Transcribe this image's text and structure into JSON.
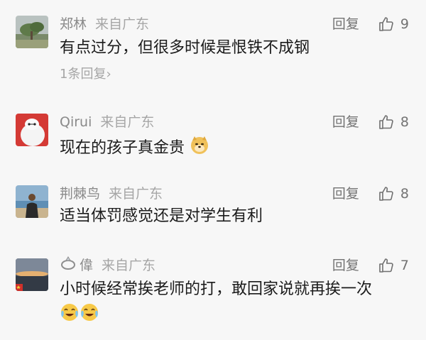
{
  "comments": [
    {
      "name": "郑林",
      "location": "来自广东",
      "reply_label": "回复",
      "likes": "9",
      "text": "有点过分，但很多时候是恨铁不成钢",
      "sub_replies": "1条回复",
      "sub_replies_arrow": "›",
      "avatar_icon": "landscape-avatar"
    },
    {
      "name": "Qirui",
      "location": "来自广东",
      "reply_label": "回复",
      "likes": "8",
      "text": "现在的孩子真金贵",
      "emoji": "doge-emoji",
      "avatar_icon": "baymax-avatar"
    },
    {
      "name": "荆棘鸟",
      "location": "来自广东",
      "reply_label": "回复",
      "likes": "8",
      "text": "适当体罚感觉还是对学生有利",
      "avatar_icon": "person-beach-avatar"
    },
    {
      "name": "偉",
      "name_badge": "ring-icon",
      "location": "来自广东",
      "reply_label": "回复",
      "likes": "7",
      "text": "小时候经常挨老师的打，敢回家说就再挨一次",
      "emoji": "crying-laughing-emoji",
      "avatar_icon": "sunset-avatar"
    }
  ],
  "colors": {
    "background": "#f7f7f7",
    "name": "#8a8a8a",
    "text": "#1b1b1b",
    "secondary": "#a6a6a6"
  }
}
